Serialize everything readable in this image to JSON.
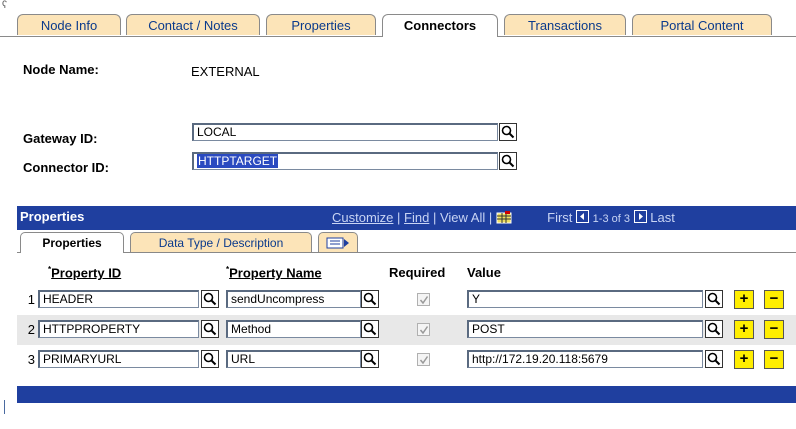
{
  "tabs": [
    {
      "label": "Node Info",
      "active": false
    },
    {
      "label": "Contact / Notes",
      "active": false
    },
    {
      "label": "Properties",
      "active": false
    },
    {
      "label": "Connectors",
      "active": true
    },
    {
      "label": "Transactions",
      "active": false
    },
    {
      "label": "Portal Content",
      "active": false
    }
  ],
  "form": {
    "node_name_label": "Node Name:",
    "node_name_value": "EXTERNAL",
    "gateway_label": "Gateway ID:",
    "gateway_value": "LOCAL",
    "connector_label": "Connector ID:",
    "connector_value": "HTTPTARGET"
  },
  "grid": {
    "title": "Properties",
    "customize": "Customize",
    "find": "Find",
    "view_all": "View All",
    "first": "First",
    "range": "1-3 of 3",
    "last": "Last",
    "subtabs": [
      {
        "label": "Properties",
        "active": true
      },
      {
        "label": "Data Type / Description",
        "active": false
      }
    ],
    "columns": {
      "property_id": "Property ID",
      "property_name": "Property Name",
      "required": "Required",
      "value": "Value"
    },
    "rows": [
      {
        "num": "1",
        "property_id": "HEADER",
        "property_name": "sendUncompress",
        "required": true,
        "value": "Y"
      },
      {
        "num": "2",
        "property_id": "HTTPPROPERTY",
        "property_name": "Method",
        "required": true,
        "value": "POST"
      },
      {
        "num": "3",
        "property_id": "PRIMARYURL",
        "property_name": "URL",
        "required": true,
        "value": "http://172.19.20.118:5679"
      }
    ],
    "add_label": "+",
    "delete_label": "−"
  },
  "icons": {
    "lookup": "magnifier-icon",
    "first": "left-arrow-icon",
    "next": "right-arrow-icon",
    "grid_download": "spreadsheet-icon",
    "expand_tab": "show-all-columns-icon"
  },
  "colors": {
    "tab_bg": "#fce4b8",
    "header_bar": "#1f3f9f",
    "link": "#0a3a8c",
    "button": "#ffee00"
  }
}
